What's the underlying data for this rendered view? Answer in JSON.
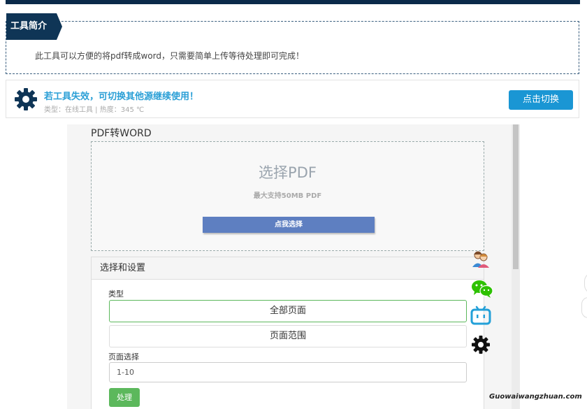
{
  "intro": {
    "tag": "工具简介",
    "text": "此工具可以方便的将pdf转成word，只需要简单上传等待处理即可完成！"
  },
  "switch_bar": {
    "title": "若工具失效，可切换其他源继续使用！",
    "subtitle": "类型：在线工具 | 热度：345 ℃",
    "button": "点击切换"
  },
  "converter": {
    "title": "PDF转WORD",
    "upload_title": "选择PDF",
    "upload_hint": "最大支持50MB PDF",
    "upload_button": "点我选择"
  },
  "settings": {
    "header": "选择和设置",
    "type_label": "类型",
    "options": [
      "全部页面",
      "页面范围"
    ],
    "selected_option": "全部页面",
    "page_label": "页面选择",
    "page_value": "1-10",
    "process_button": "处理"
  },
  "side_icons": [
    "users-icon",
    "wechat-icon",
    "bilibili-icon",
    "gear-icon"
  ],
  "watermark": "Guowaiwangzhuan.com",
  "colors": {
    "brand_dark": "#0f3556",
    "accent_blue": "#1a96d4",
    "success_green": "#5cb85c",
    "upload_button": "#5e7fc1"
  }
}
